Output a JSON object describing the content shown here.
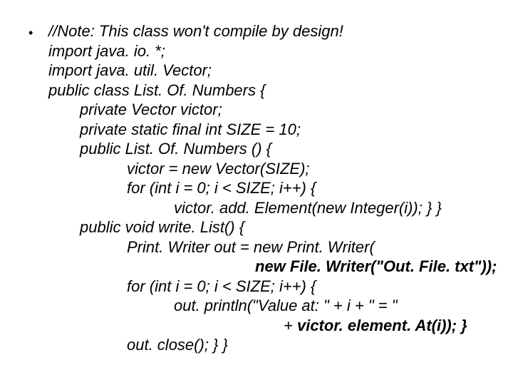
{
  "code": {
    "l1": "//Note: This class won't compile by design!",
    "l2": "import java. io. *;",
    "l3": "import java. util. Vector;",
    "l4": "public class List. Of. Numbers {",
    "l5": "private Vector victor;",
    "l6": "private static final int SIZE = 10;",
    "l7": "public List. Of. Numbers () {",
    "l8": "victor = new Vector(SIZE);",
    "l9": "for (int i = 0; i < SIZE; i++) {",
    "l10": "victor. add. Element(new Integer(i)); } }",
    "l11": "public void write. List() {",
    "l12": "Print. Writer out = new Print. Writer(",
    "l13": "new File. Writer(\"Out. File. txt\"));",
    "l14": "for (int i = 0; i < SIZE; i++) {",
    "l15a": "out. println(\"Value at: \" + i + \" = \"",
    "l15b": "+ ",
    "l15c": "victor. element. At(i)); }",
    "l16": "out. close(); } }"
  }
}
